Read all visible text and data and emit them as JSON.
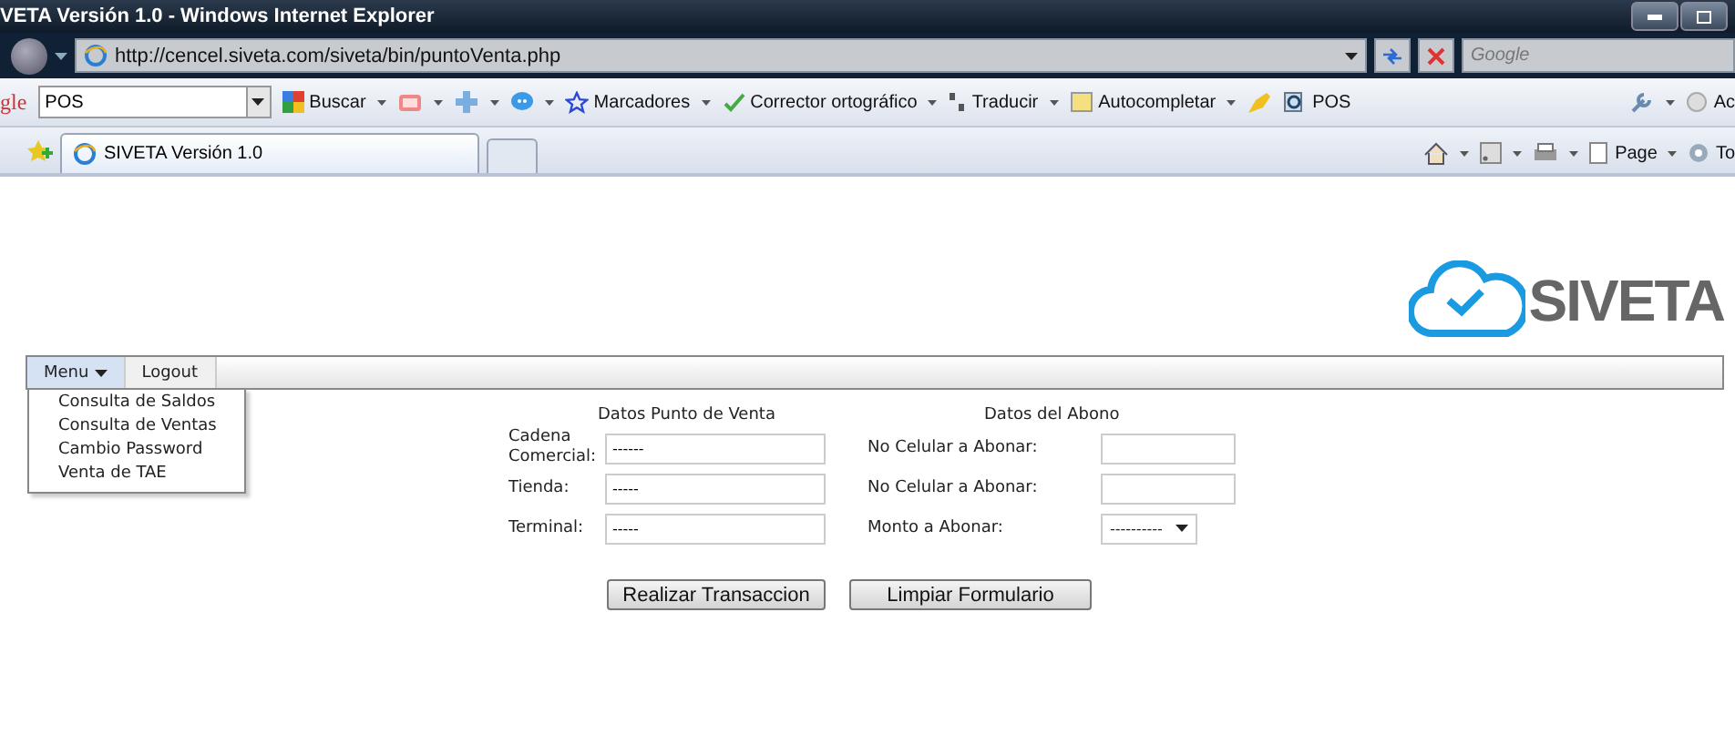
{
  "window": {
    "title": "VETA Versión 1.0 - Windows Internet Explorer"
  },
  "address_bar": {
    "url": "http://cencel.siveta.com/siveta/bin/puntoVenta.php",
    "search_placeholder": "Google"
  },
  "toolbar": {
    "logo": "gle",
    "search_value": "POS",
    "labels": [
      "Buscar",
      "Marcadores",
      "Corrector ortográfico",
      "Traducir",
      "Autocompletar",
      "POS",
      "Ac"
    ]
  },
  "tabs": [
    {
      "label": "SIVETA Versión 1.0",
      "selected": true
    }
  ],
  "command_bar": {
    "labels": [
      "Page",
      "To"
    ]
  },
  "site": {
    "logo": "SIVETA"
  },
  "nav": [
    {
      "label": "Menu",
      "expanded": true,
      "items": [
        "Consulta de Saldos",
        "Consulta de Ventas",
        "Cambio Password",
        "Venta de TAE"
      ]
    },
    {
      "label": "Logout",
      "expanded": false
    }
  ],
  "form": {
    "sections": [
      {
        "title": "Datos Punto de Venta",
        "fields": [
          {
            "kind": "text",
            "label": "Cadena Comercial:",
            "value": "------"
          },
          {
            "kind": "text",
            "label": "Tienda:",
            "value": "-----"
          },
          {
            "kind": "text",
            "label": "Terminal:",
            "value": "-----"
          }
        ]
      },
      {
        "title": "Datos del Abono",
        "fields": [
          {
            "kind": "text",
            "label": "No Celular a Abonar:"
          },
          {
            "kind": "text",
            "label": "No Celular a Abonar:"
          },
          {
            "kind": "select",
            "label": "Monto a Abonar:",
            "value": "----------"
          }
        ]
      }
    ],
    "buttons": [
      "Realizar Transaccion",
      "Limpiar Formulario"
    ]
  }
}
